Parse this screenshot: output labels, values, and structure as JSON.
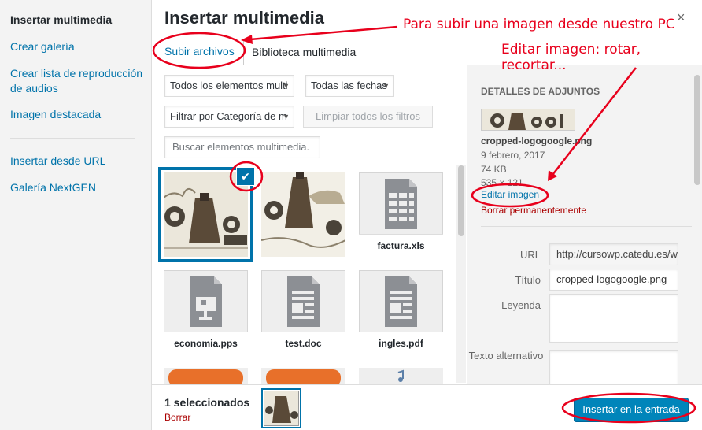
{
  "menu": {
    "items": [
      {
        "label": "Insertar multimedia",
        "active": true
      },
      {
        "label": "Crear galería"
      },
      {
        "label": "Crear lista de reproducción de audios"
      },
      {
        "label": "Imagen destacada"
      },
      {
        "label": "Insertar desde URL"
      },
      {
        "label": "Galería NextGEN"
      }
    ]
  },
  "header": {
    "title": "Insertar multimedia",
    "close_icon": "×"
  },
  "tabs": [
    {
      "label": "Subir archivos"
    },
    {
      "label": "Biblioteca multimedia",
      "active": true
    }
  ],
  "toolbar": {
    "type_filter": "Todos los elementos multi",
    "date_filter": "Todas las fechas",
    "category_filter": "Filtrar por Categoría de m",
    "clear_button": "Limpiar todos los filtros",
    "search_placeholder": "Buscar elementos multimedia."
  },
  "grid": {
    "items": [
      {
        "type": "image",
        "name": "",
        "selected": true
      },
      {
        "type": "image",
        "name": ""
      },
      {
        "type": "spreadsheet",
        "name": "factura.xls"
      },
      {
        "type": "presentation",
        "name": "economia.pps"
      },
      {
        "type": "document",
        "name": "test.doc"
      },
      {
        "type": "document",
        "name": "ingles.pdf"
      }
    ]
  },
  "details": {
    "heading": "DETALLES DE ADJUNTOS",
    "filename": "cropped-logogoogle.png",
    "date": "9 febrero, 2017",
    "size": "74 KB",
    "dimensions": "535 × 121",
    "edit_link": "Editar imagen",
    "delete_link": "Borrar permanentemente",
    "fields": {
      "url_label": "URL",
      "url_value": "http://cursowp.catedu.es/w",
      "title_label": "Título",
      "title_value": "cropped-logogoogle.png",
      "caption_label": "Leyenda",
      "alt_label": "Texto alternativo"
    }
  },
  "footer": {
    "selected_count": "1 seleccionados",
    "clear_link": "Borrar",
    "insert_button": "Insertar en la entrada"
  },
  "annotations": {
    "upload_note": "Para subir una imagen desde nuestro PC",
    "edit_note": "Editar imagen: rotar, recortar...",
    "color": "#e8001c"
  },
  "colors": {
    "accent": "#0073aa",
    "primary_button": "#0085ba",
    "danger": "#a00"
  }
}
